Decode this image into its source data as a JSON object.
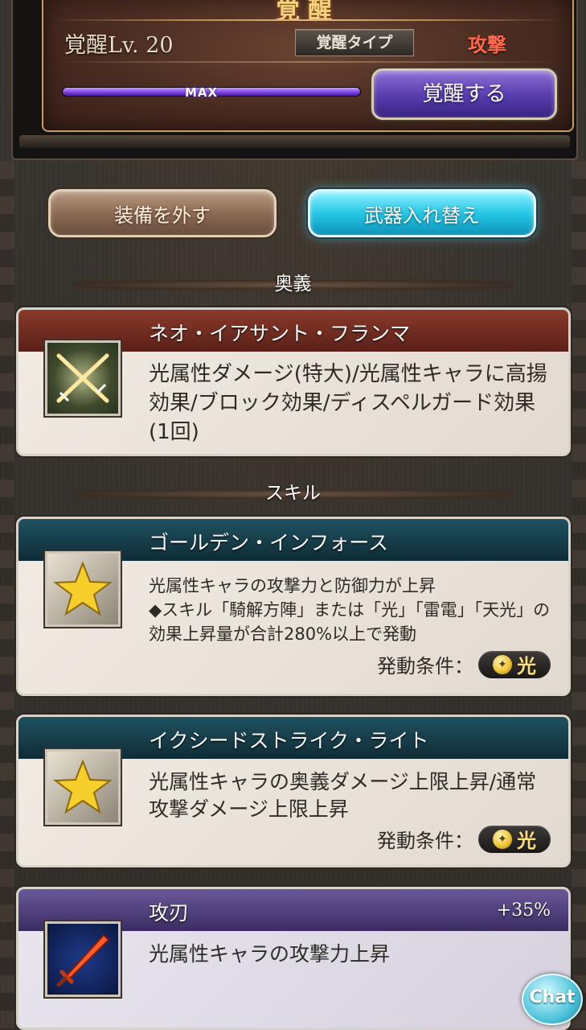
{
  "awakening": {
    "title": "覚醒",
    "level_text": "覚醒Lv. 20",
    "type_label": "覚醒タイプ",
    "type_value": "攻撃",
    "gauge_label": "MAX",
    "gauge_fill_pct": 100,
    "awaken_button": "覚醒する"
  },
  "actions": {
    "unequip": "装備を外す",
    "swap_weapon": "武器入れ替え"
  },
  "sections": {
    "ougi": "奥義",
    "skill": "スキル"
  },
  "ougi": {
    "name": "ネオ・イアサント・フランマ",
    "description": "光属性ダメージ(特大)/光属性キャラに高揚効果/ブロック効果/ディスペルガード効果(1回)",
    "icon": "crossed-swords-icon"
  },
  "skills": [
    {
      "name": "ゴールデン・インフォース",
      "description": "光属性キャラの攻撃力と防御力が上昇\n◆スキル「騎解方陣」または「光」「雷電」「天光」の効果上昇量が合計280%以上で発動",
      "condition_label": "発動条件：",
      "condition_value": "光",
      "icon": "gold-star-icon"
    },
    {
      "name": "イクシードストライク・ライト",
      "description": "光属性キャラの奥義ダメージ上限上昇/通常攻撃ダメージ上限上昇",
      "condition_label": "発動条件：",
      "condition_value": "光",
      "icon": "gold-star-icon"
    },
    {
      "name": "攻刃",
      "value": "+35%",
      "description": "光属性キャラの攻撃力上昇",
      "icon": "red-blade-icon"
    }
  ],
  "chat": {
    "label": "Chat"
  },
  "colors": {
    "type_value": "#ff6a4a",
    "gauge": "#7a3ee0",
    "swap_button": "#27c7e6",
    "ougi_header": "#7a2f22",
    "skill_header": "#173f4c",
    "passive_header": "#463670"
  }
}
